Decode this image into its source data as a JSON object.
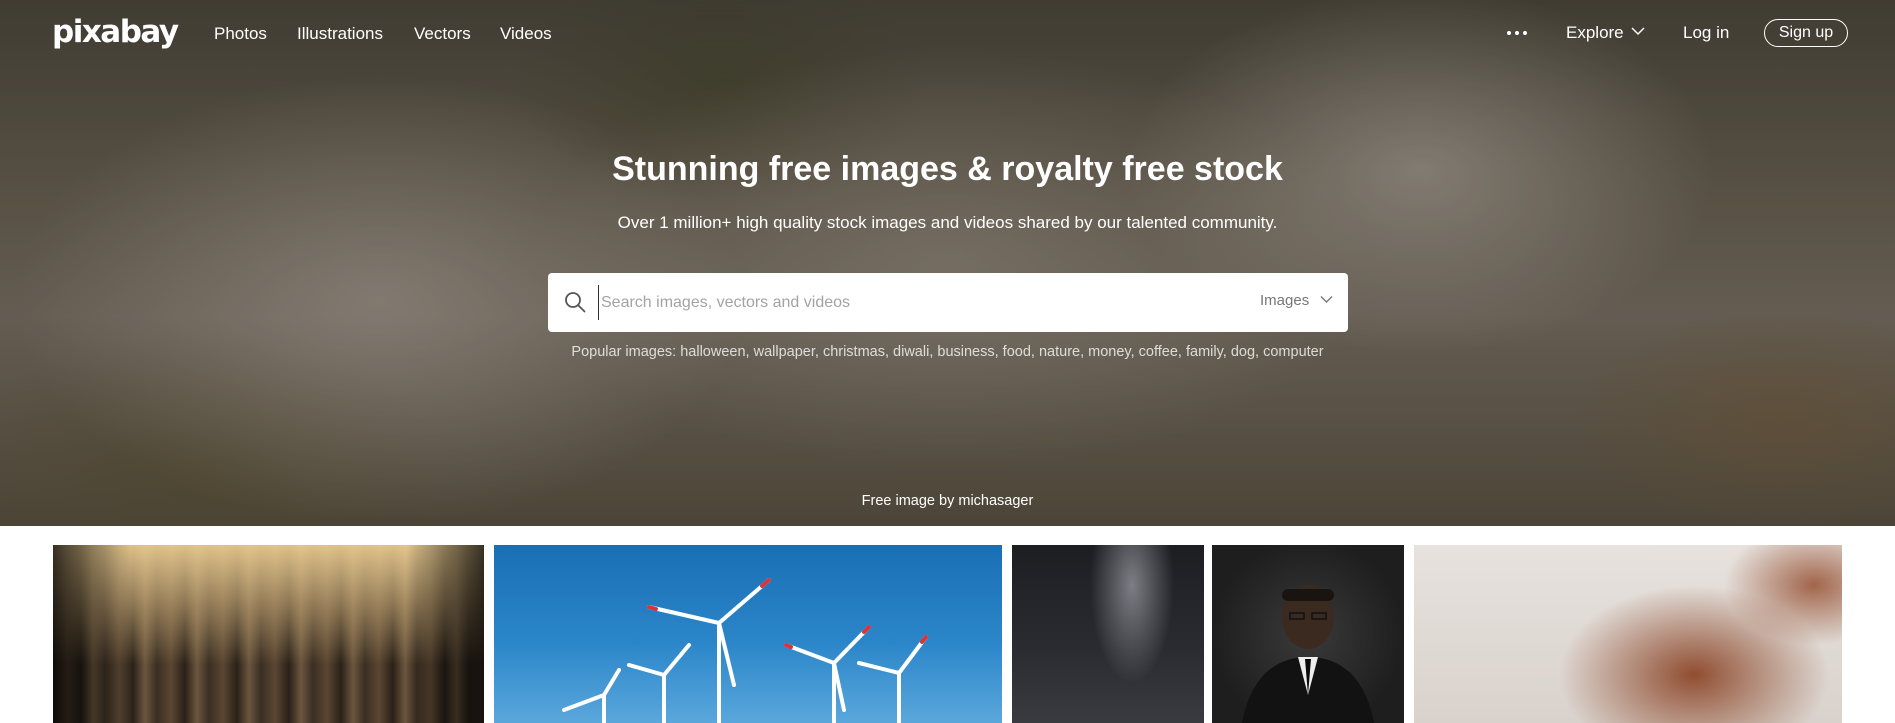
{
  "brand": {
    "logo_text": "pixabay"
  },
  "nav": {
    "links": [
      {
        "label": "Photos"
      },
      {
        "label": "Illustrations"
      },
      {
        "label": "Vectors"
      },
      {
        "label": "Videos"
      }
    ],
    "more_icon": "ellipsis-icon",
    "explore_label": "Explore",
    "login_label": "Log in",
    "signup_label": "Sign up"
  },
  "hero": {
    "title": "Stunning free images & royalty free stock",
    "subtitle": "Over 1 million+ high quality stock images and videos shared by our talented community.",
    "search": {
      "placeholder": "Search images, vectors and videos",
      "value": "",
      "type_selected": "Images",
      "icon": "search-icon"
    },
    "popular": {
      "prefix": "Popular images:",
      "tags": [
        "halloween",
        "wallpaper",
        "christmas",
        "diwali",
        "business",
        "food",
        "nature",
        "money",
        "coffee",
        "family",
        "dog",
        "computer"
      ]
    },
    "credit": "Free image by michasager"
  },
  "gallery": {
    "tiles": [
      {
        "subject": "columns-colonnade"
      },
      {
        "subject": "wind-turbines"
      },
      {
        "subject": "milky-way-night"
      },
      {
        "subject": "man-in-suit-portrait"
      },
      {
        "subject": "autumn-leaf"
      }
    ]
  },
  "colors": {
    "text_on_hero": "#ffffff",
    "search_bg": "#ffffff",
    "placeholder": "#a3a3a3",
    "page_bg": "#ffffff"
  }
}
